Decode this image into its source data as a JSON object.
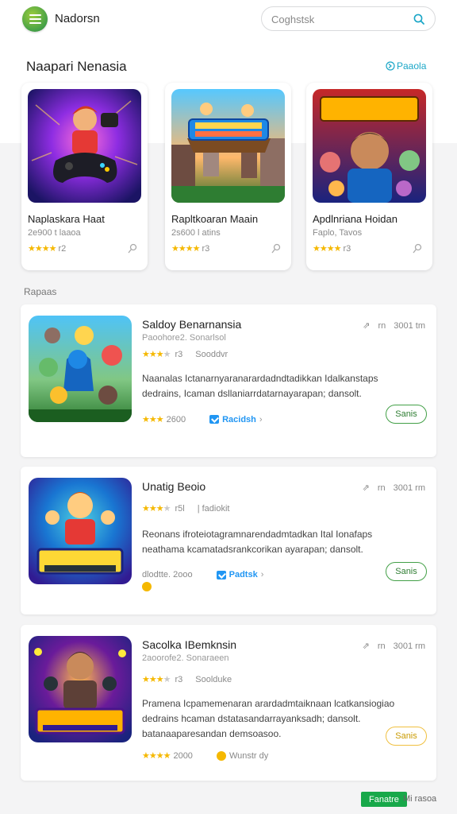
{
  "header": {
    "brand": "Nadorsn",
    "search_placeholder": "Coghstsk"
  },
  "featured": {
    "title": "Naapari Nenasia",
    "see_all": "Paaola",
    "items": [
      {
        "title": "Naplaskara Haat",
        "sub": "2e900 t laaoa",
        "rating": "r2",
        "stars": 4
      },
      {
        "title": "Rapltkoaran Maain",
        "sub": "2s600 l atins",
        "rating": "r3",
        "stars": 4
      },
      {
        "title": "Apdlnriana Hoidan",
        "sub": "Faplo, Tavos",
        "rating": "r3",
        "stars": 4
      }
    ]
  },
  "popular_label": "Rapaas",
  "list": [
    {
      "title": "Saldoy Benarnansia",
      "sub": "Paoohore2. Sonarlsol",
      "rating": "r3",
      "tag": "Sooddvr",
      "meta_left": "rn",
      "meta_right": "3001 tm",
      "desc": "Naanalas Ictanarnyaranarardadndtadikkan Idalkanstaps dedrains, Icaman dsllaniarrdatarnayarapan; dansolt.",
      "bottom_left": "2600",
      "badge": "Racidsh",
      "button": "Sanis"
    },
    {
      "title": "Unatig Beoio",
      "sub": "",
      "rating": "r5l",
      "tag": "| fadiokit",
      "meta_left": "rn",
      "meta_right": "3001 rm",
      "desc": "Reonans ifroteiotagramnarendadmtadkan Ital Ionafaps neathama kcamatadsrankcorikan ayarapan; dansolt.",
      "bottom_left": "dlodtte. 2ooo",
      "badge": "Padtsk",
      "button": "Sanis"
    },
    {
      "title": "Sacolka IBemknsin",
      "sub": "2aoorofe2. Sonaraeen",
      "rating": "r3",
      "tag": "Soolduke",
      "meta_left": "rn",
      "meta_right": "3001 rm",
      "desc": "Pramena Icpamemenaran arardadmtaiknaan lcatkansiogiao dedrains hcaman dstatasandarrayanksadh; dansolt. batanaaparesandan demsoasoo.",
      "bottom_left": "2000",
      "badge": "Wunstr dy",
      "button": "Sanis"
    }
  ],
  "footer": {
    "tag": "Fanatre",
    "text": "Mi rasoa"
  },
  "colors": {
    "accent_green": "#43a047",
    "link_blue": "#1aa6c7",
    "star": "#f5b800",
    "badge_blue": "#2196f3"
  }
}
